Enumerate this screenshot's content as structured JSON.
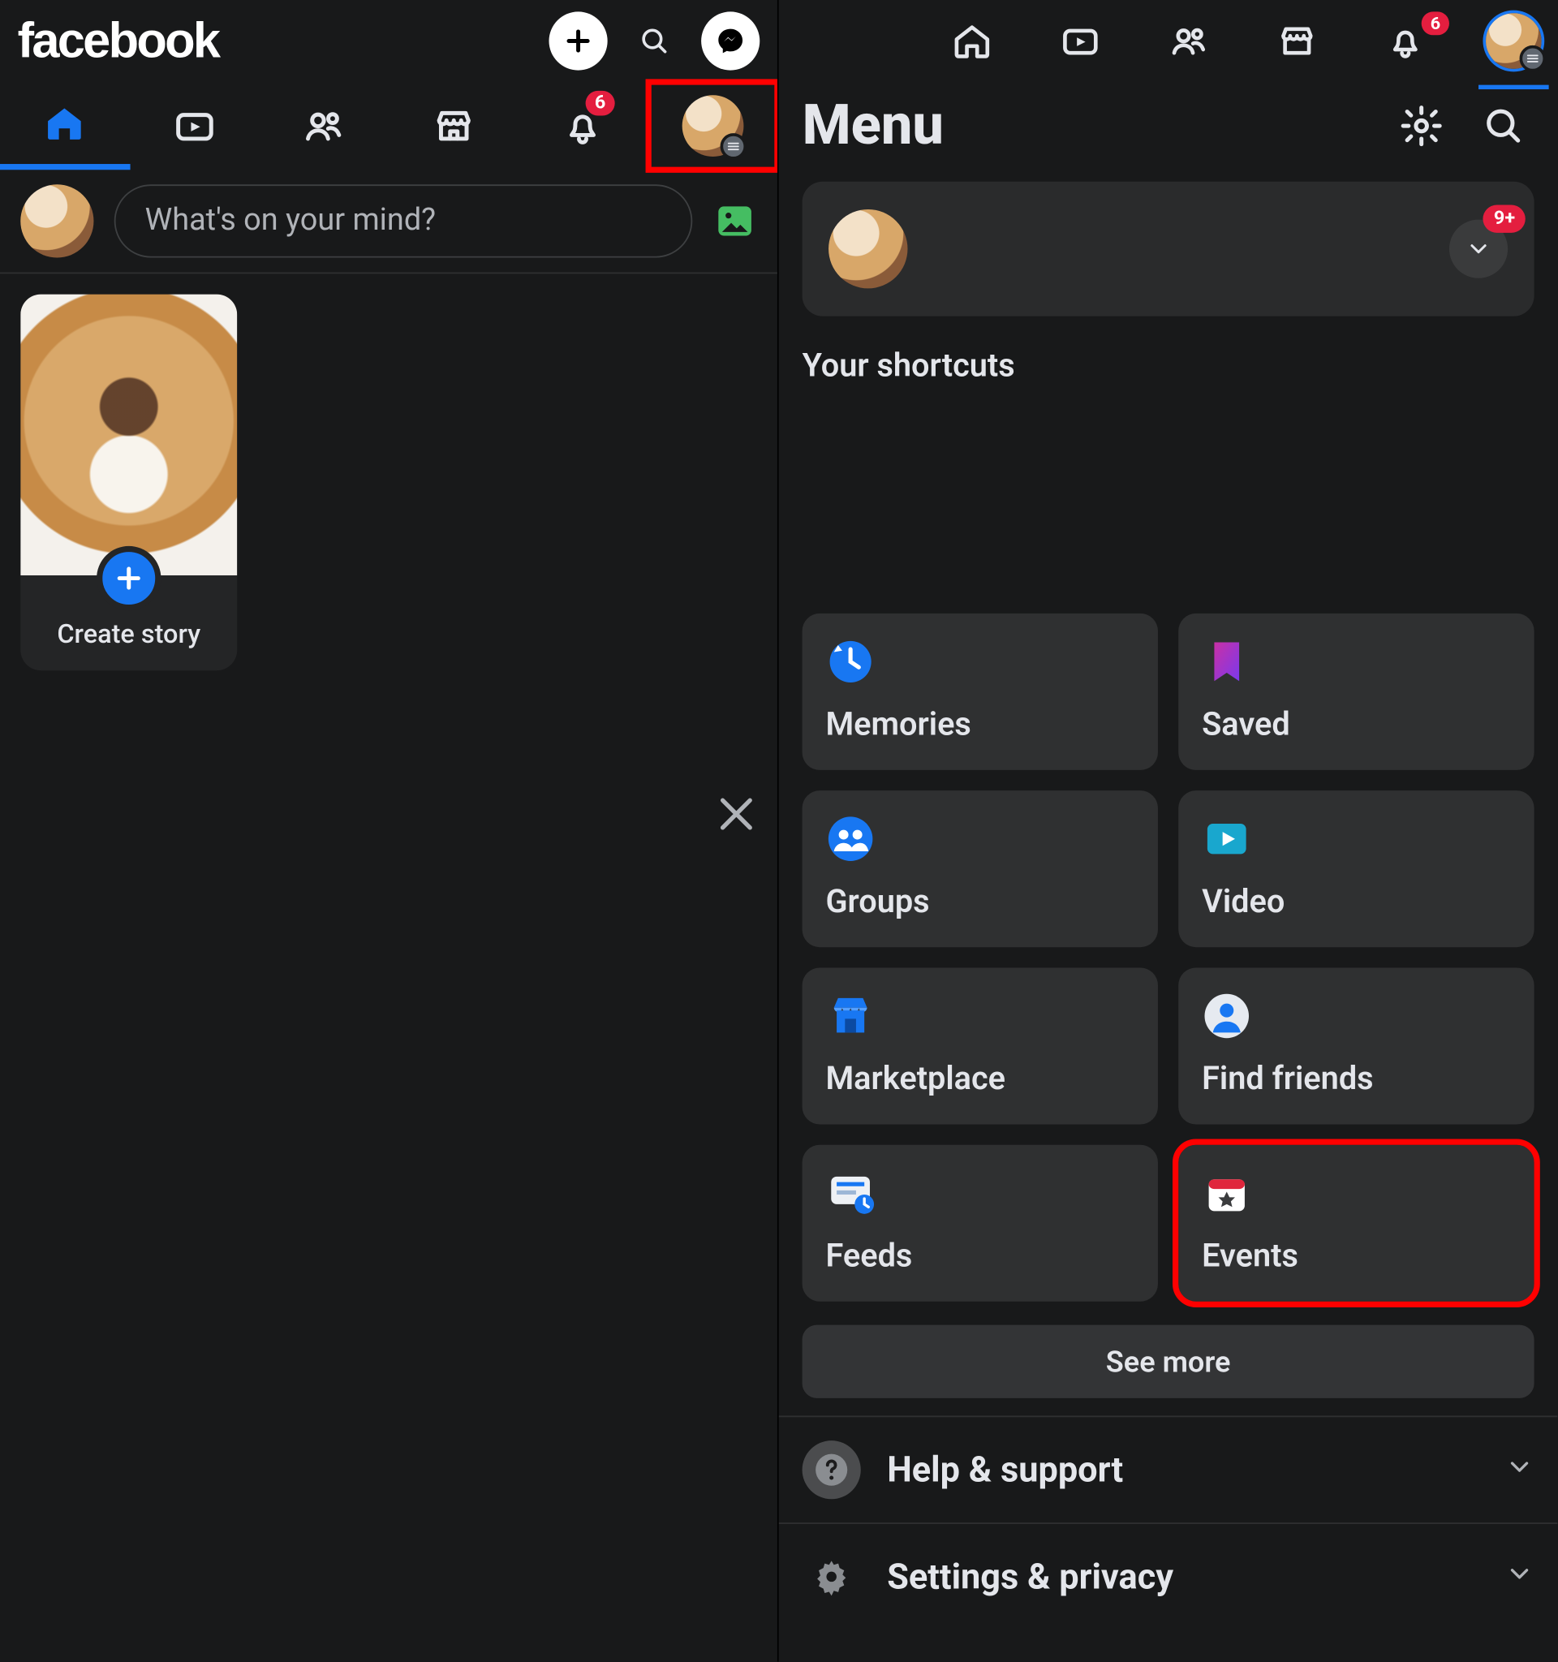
{
  "left": {
    "logo": "facebook",
    "nav_badge_notifications": "6",
    "composer_placeholder": "What's on your mind?",
    "create_story": "Create story"
  },
  "right": {
    "top_badge_notifications": "6",
    "menu_title": "Menu",
    "profile_badge": "9+",
    "shortcuts_label": "Your shortcuts",
    "tiles": [
      {
        "label": "Memories"
      },
      {
        "label": "Saved"
      },
      {
        "label": "Groups"
      },
      {
        "label": "Video"
      },
      {
        "label": "Marketplace"
      },
      {
        "label": "Find friends"
      },
      {
        "label": "Feeds"
      },
      {
        "label": "Events"
      }
    ],
    "see_more": "See more",
    "help_support": "Help & support",
    "settings_privacy": "Settings & privacy"
  }
}
